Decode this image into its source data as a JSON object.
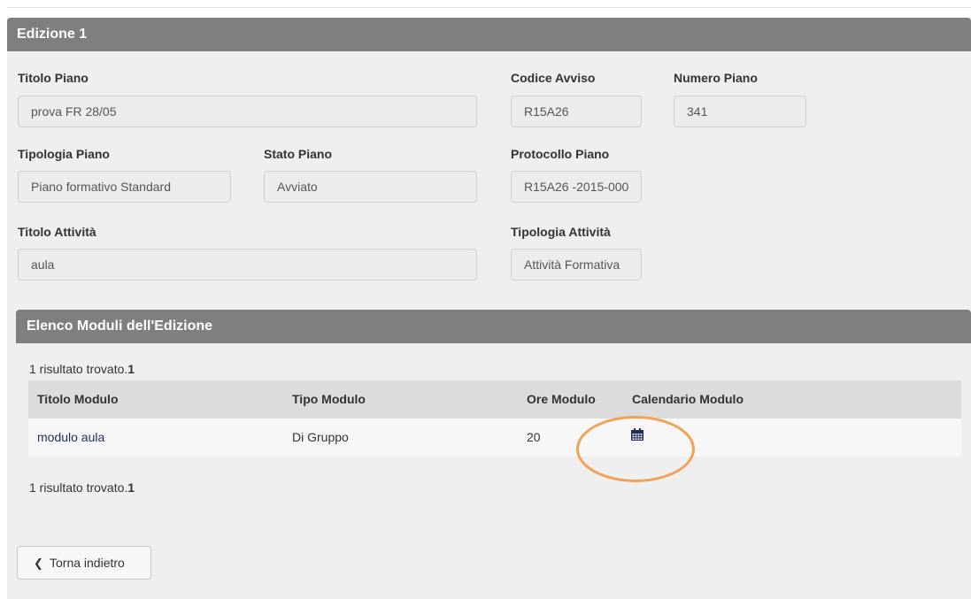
{
  "edition": {
    "title": "Edizione 1",
    "fields": {
      "titolo_piano": {
        "label": "Titolo Piano",
        "value": "prova FR 28/05"
      },
      "codice_avviso": {
        "label": "Codice Avviso",
        "value": "R15A26"
      },
      "numero_piano": {
        "label": "Numero Piano",
        "value": "341"
      },
      "tipologia_piano": {
        "label": "Tipologia Piano",
        "value": "Piano formativo Standard"
      },
      "stato_piano": {
        "label": "Stato Piano",
        "value": "Avviato"
      },
      "protocollo_piano": {
        "label": "Protocollo Piano",
        "value": "R15A26 -2015-000"
      },
      "titolo_attivita": {
        "label": "Titolo Attività",
        "value": "aula"
      },
      "tipologia_attivita": {
        "label": "Tipologia Attività",
        "value": "Attività Formativa"
      }
    }
  },
  "modules": {
    "title": "Elenco Moduli dell'Edizione",
    "count_text": "1 risultato trovato.",
    "count_value": "1",
    "columns": [
      "Titolo Modulo",
      "Tipo Modulo",
      "Ore Modulo",
      "Calendario Modulo"
    ],
    "rows": [
      {
        "titolo": "modulo aula",
        "tipo": "Di Gruppo",
        "ore": "20",
        "calendario_icon": "calendar-icon"
      }
    ]
  },
  "back_button": {
    "label": "Torna indietro",
    "icon": "chevron-left-icon"
  },
  "colors": {
    "header": "#7f7f7f",
    "panel": "#efefef",
    "highlight": "#f2a257",
    "link": "#1f2d5a"
  }
}
